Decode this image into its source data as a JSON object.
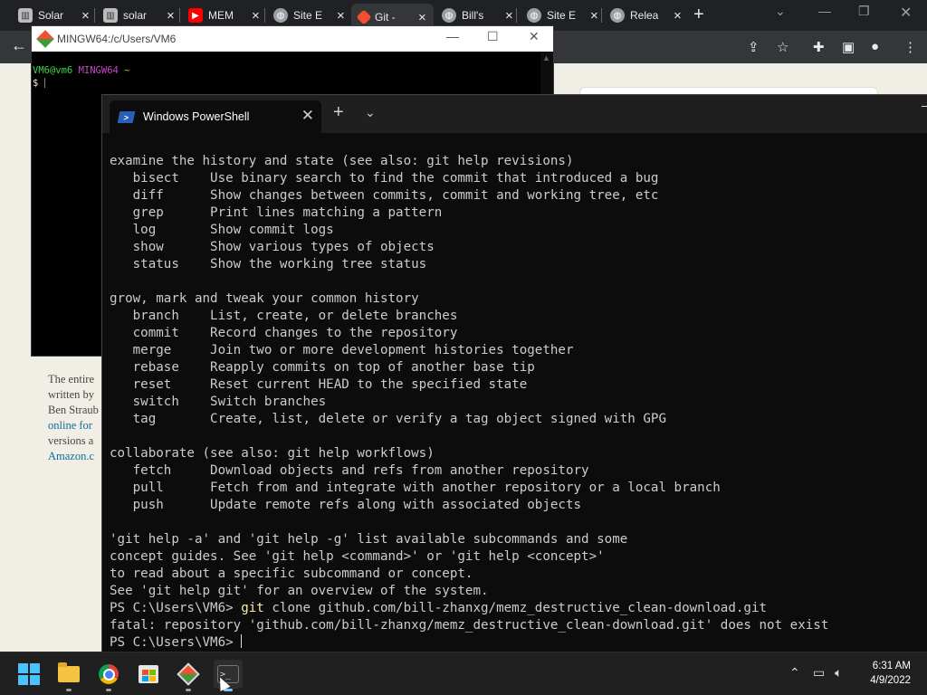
{
  "browser": {
    "tabs": [
      {
        "title": "Solar",
        "icon": "bank-icon",
        "color": "#cccccc"
      },
      {
        "title": "solar",
        "icon": "bank-icon",
        "color": "#cccccc"
      },
      {
        "title": "MEM",
        "icon": "youtube-icon",
        "color": "#ff0000"
      },
      {
        "title": "Site E",
        "icon": "globe-icon",
        "color": "#9aa0a6"
      },
      {
        "title": "Git -",
        "icon": "git-icon",
        "color": "#f1502f"
      },
      {
        "title": "Bill's",
        "icon": "globe-icon",
        "color": "#9aa0a6"
      },
      {
        "title": "Site E",
        "icon": "globe-icon",
        "color": "#9aa0a6"
      },
      {
        "title": "Relea",
        "icon": "globe-icon",
        "color": "#9aa0a6"
      }
    ],
    "new_tab": "+",
    "page_text": {
      "lines": [
        "The entire",
        "written by",
        "Ben Straub"
      ],
      "link1": "online for",
      "line4": "versions a",
      "link2": "Amazon.c"
    }
  },
  "mingw": {
    "title": "MINGW64:/c/Users/VM6",
    "prompt_user": "VM6@vm6",
    "prompt_env": "MINGW64",
    "prompt_path": "~",
    "prompt_symbol": "$"
  },
  "terminal": {
    "tab_title": "Windows PowerShell",
    "lines": [
      {
        "text": "examine the history and state (see also: git help revisions)"
      },
      {
        "text": "   bisect    Use binary search to find the commit that introduced a bug"
      },
      {
        "text": "   diff      Show changes between commits, commit and working tree, etc"
      },
      {
        "text": "   grep      Print lines matching a pattern"
      },
      {
        "text": "   log       Show commit logs"
      },
      {
        "text": "   show      Show various types of objects"
      },
      {
        "text": "   status    Show the working tree status"
      },
      {
        "text": ""
      },
      {
        "text": "grow, mark and tweak your common history"
      },
      {
        "text": "   branch    List, create, or delete branches"
      },
      {
        "text": "   commit    Record changes to the repository"
      },
      {
        "text": "   merge     Join two or more development histories together"
      },
      {
        "text": "   rebase    Reapply commits on top of another base tip"
      },
      {
        "text": "   reset     Reset current HEAD to the specified state"
      },
      {
        "text": "   switch    Switch branches"
      },
      {
        "text": "   tag       Create, list, delete or verify a tag object signed with GPG"
      },
      {
        "text": ""
      },
      {
        "text": "collaborate (see also: git help workflows)"
      },
      {
        "text": "   fetch     Download objects and refs from another repository"
      },
      {
        "text": "   pull      Fetch from and integrate with another repository or a local branch"
      },
      {
        "text": "   push      Update remote refs along with associated objects"
      },
      {
        "text": ""
      },
      {
        "text": "'git help -a' and 'git help -g' list available subcommands and some"
      },
      {
        "text": "concept guides. See 'git help <command>' or 'git help <concept>'"
      },
      {
        "text": "to read about a specific subcommand or concept."
      },
      {
        "text": "See 'git help git' for an overview of the system."
      }
    ],
    "clone_prompt": "PS C:\\Users\\VM6> ",
    "clone_cmd": "git",
    "clone_args": " clone github.com/bill-zhanxg/memz_destructive_clean-download.git",
    "error_line": "fatal: repository 'github.com/bill-zhanxg/memz_destructive_clean-download.git' does not exist",
    "final_prompt": "PS C:\\Users\\VM6> "
  },
  "taskbar": {
    "time": "6:31 AM",
    "date": "4/9/2022",
    "apps": [
      "start-icon",
      "file-explorer-icon",
      "chrome-icon",
      "store-icon",
      "git-extensions-icon",
      "terminal-icon"
    ]
  }
}
